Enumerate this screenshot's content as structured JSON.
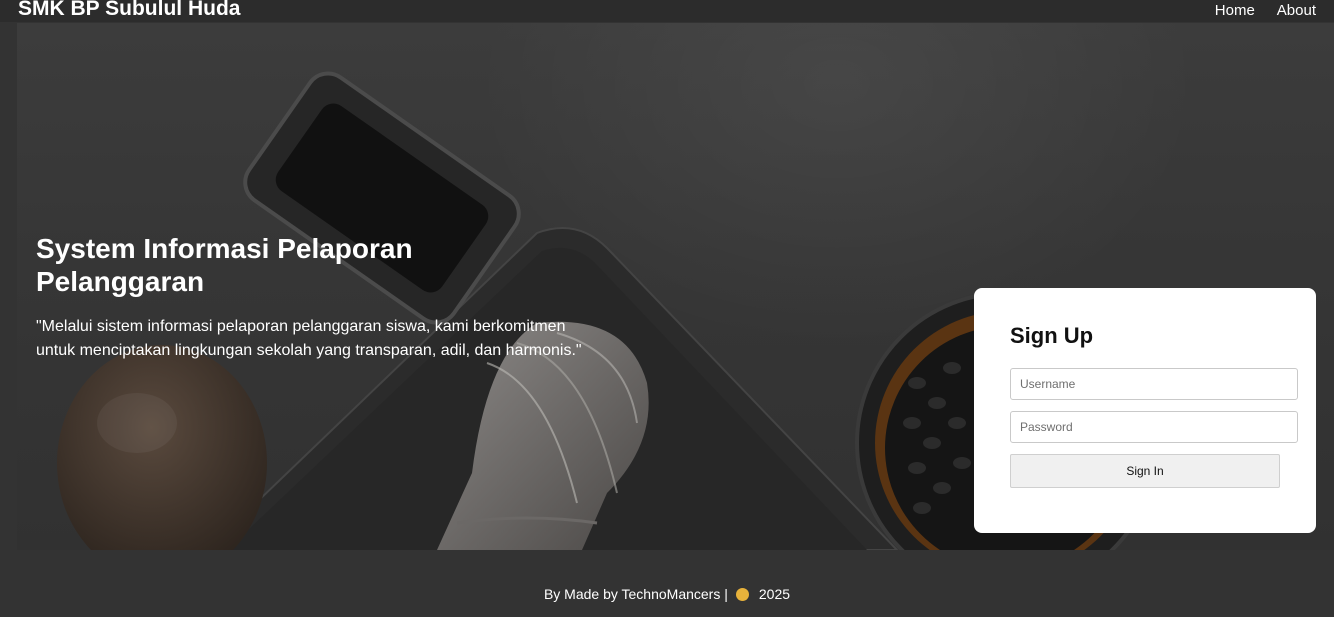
{
  "navbar": {
    "brand": "SMK BP Subulul Huda",
    "links": [
      "Home",
      "About"
    ]
  },
  "hero": {
    "title": "System Informasi Pelaporan Pelanggaran",
    "quote": "\"Melalui sistem informasi pelaporan pelanggaran siswa, kami berkomitmen untuk menciptakan lingkungan sekolah yang transparan, adil, dan harmonis.\""
  },
  "signup": {
    "title": "Sign Up",
    "username_placeholder": "Username",
    "password_placeholder": "Password",
    "button_label": "Sign In"
  },
  "footer": {
    "text": "By Made by TechnoMancers |",
    "year": "2025",
    "accent_color": "#e7b23b"
  }
}
